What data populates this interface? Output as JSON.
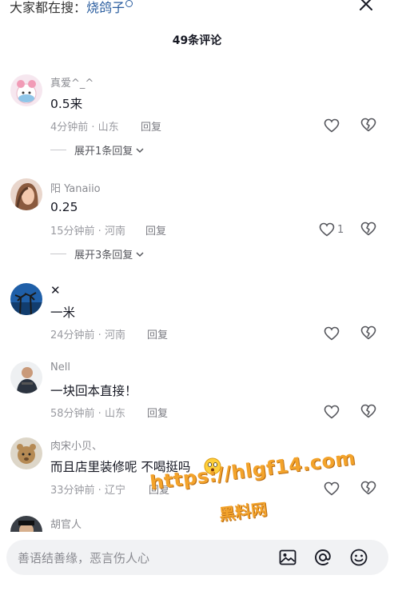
{
  "header": {
    "search_prefix": "大家都在搜：",
    "search_keyword": "烧鸽子",
    "comment_count": "49条评论"
  },
  "comments": [
    {
      "author": "真爱^_^",
      "text": "0.5来",
      "meta": "4分钟前 · 山东",
      "reply": "回复",
      "likes": "",
      "expand": "展开1条回复"
    },
    {
      "author": "阳  Yanaiio",
      "text": "0.25",
      "meta": "15分钟前 · 河南",
      "reply": "回复",
      "likes": "1",
      "expand": "展开3条回复"
    },
    {
      "author": "✕",
      "text": "一米",
      "meta": "24分钟前 · 河南",
      "reply": "回复",
      "likes": ""
    },
    {
      "author": "Nell",
      "text": "一块回本直接！",
      "meta": "58分钟前 · 山东",
      "reply": "回复",
      "likes": ""
    },
    {
      "author": "肉宋小贝、",
      "text": "而且店里装修呢  不喝挺吗",
      "meta": "33分钟前 · 辽宁",
      "reply": "回复",
      "likes": ""
    },
    {
      "author": "胡官人"
    }
  ],
  "watermark": {
    "line1": "https://hlgf14.com",
    "line2": "黑料网"
  },
  "input": {
    "placeholder": "善语结善缘，恶言伤人心"
  },
  "icons": [
    "search-icon",
    "close-icon",
    "heart-icon",
    "dislike-icon",
    "chevron-down-icon",
    "image-icon",
    "at-icon",
    "emoji-icon"
  ]
}
